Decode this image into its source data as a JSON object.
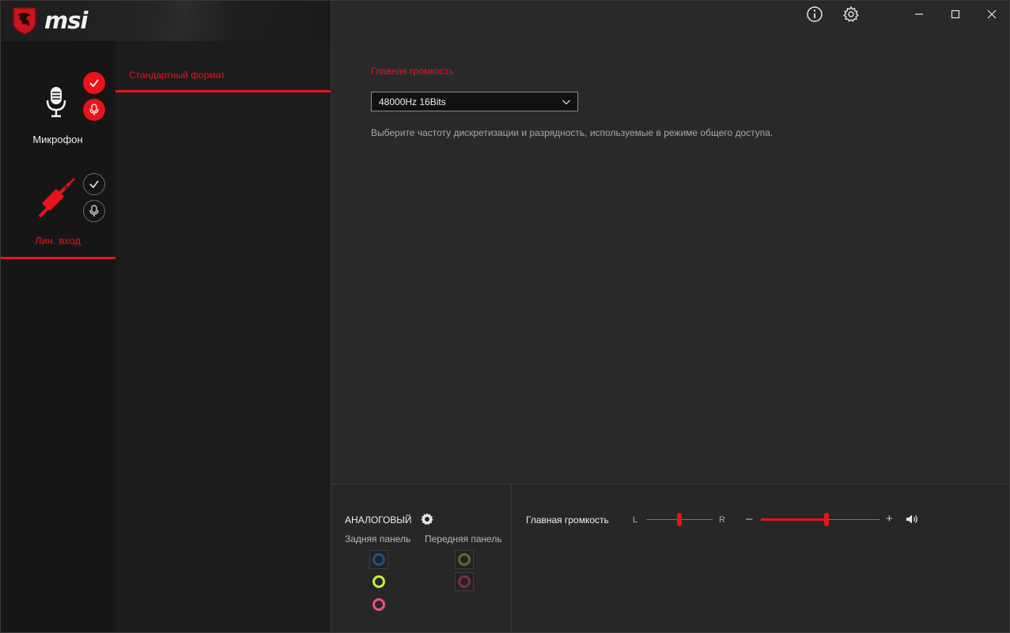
{
  "app": {
    "logo_text": "msi"
  },
  "devices": [
    {
      "label": "Микрофон",
      "active": false
    },
    {
      "label": "Лин. вход",
      "active": true
    }
  ],
  "subnav": {
    "tab_label": "Стандартный формат"
  },
  "main": {
    "section_title": "Главная громкость",
    "format_value": "48000Hz 16Bits",
    "description": "Выберите частоту дискретизации и разрядность, используемые в режиме общего доступа."
  },
  "analog": {
    "title": "АНАЛОГОВЫЙ",
    "rear_label": "Задняя панель",
    "front_label": "Передняя панель",
    "jack_colors": {
      "rear_blue": "#1f4f8f",
      "rear_lime": "#c6f033",
      "rear_pink": "#f0508a",
      "front_green": "#5d6f1c",
      "front_pink": "#7e2c47"
    }
  },
  "volume": {
    "label": "Главная громкость",
    "left": "L",
    "right": "R",
    "minus": "–",
    "plus": "+",
    "balance_position": 0.5,
    "level_percent": 55
  },
  "colors": {
    "accent": "#e8131b",
    "background": "#292929"
  },
  "icons": {
    "info": "info-icon",
    "settings": "gear-icon",
    "minimize": "minimize-icon",
    "maximize": "maximize-icon",
    "close": "close-icon"
  }
}
